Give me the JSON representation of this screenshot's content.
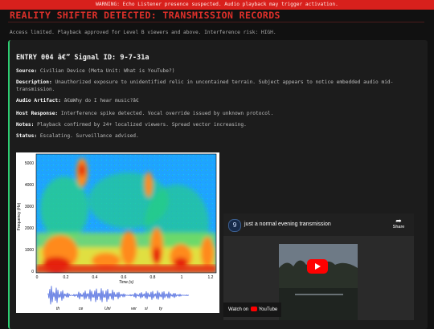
{
  "warning_bar": "WARNING: Echo Listener presence suspected. Audio playback may trigger activation.",
  "page_title": "REALITY SHIFTER DETECTED: TRANSMISSION RECORDS",
  "subtitle": "Access limited. Playback approved for Level B viewers and above. Interference risk: HIGH.",
  "entry": {
    "heading": "ENTRY 004 â€” Signal ID: 9-7-31a",
    "fields": [
      {
        "label": "Source:",
        "value": "Civilian Device (Meta Unit: What is YouTube?)"
      },
      {
        "label": "Description:",
        "value": "Unauthorized exposure to unidentified relic in uncontained terrain. Subject appears to notice embedded audio mid-transmission."
      },
      {
        "label": "Audio Artifact:",
        "value": "â€œWhy do I hear music?â€"
      },
      {
        "label": "Host Response:",
        "value": "Interference spike detected. Vocal override issued by unknown protocol."
      },
      {
        "label": "Notes:",
        "value": "Playback confirmed by 24+ localized viewers. Spread vector increasing."
      },
      {
        "label": "Status:",
        "value": "Escalating. Surveillance advised."
      }
    ]
  },
  "spectrogram": {
    "ylabel": "Frequency (Hz)",
    "xlabel": "Time (s)",
    "y_ticks": [
      "5000",
      "4000",
      "3000",
      "2000",
      "1000",
      "0"
    ],
    "x_ticks": [
      "0",
      "0.2",
      "0.4",
      "0.6",
      "0.8",
      "1",
      "1.2"
    ],
    "syllables": [
      "th",
      "ce",
      "Uni",
      "ver",
      "si",
      "ty"
    ]
  },
  "video": {
    "title": "just a normal evening transmission",
    "share_label": "Share",
    "watch_on": "Watch on",
    "platform": "YouTube",
    "logo_glyph": "9"
  }
}
